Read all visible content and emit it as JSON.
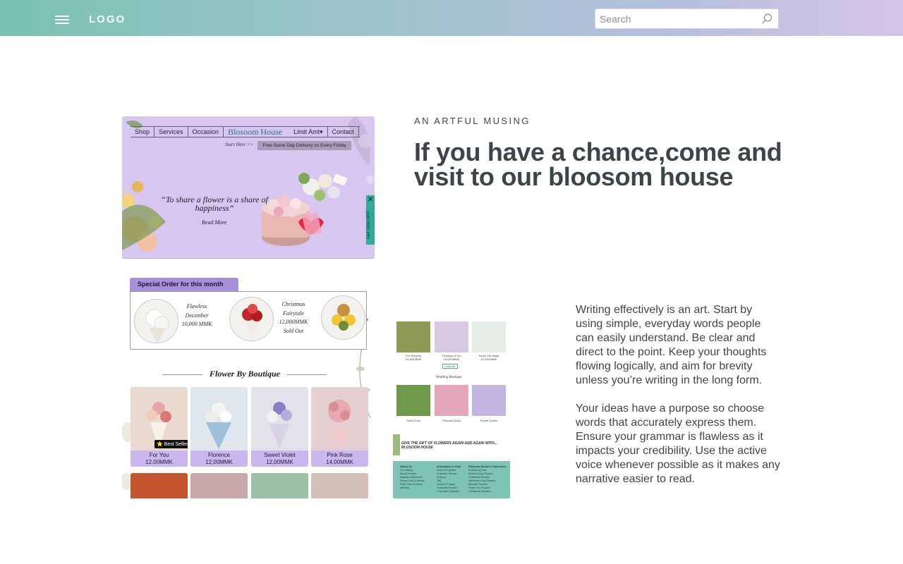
{
  "topbar": {
    "logo": "LOGO",
    "search_placeholder": "Search"
  },
  "intro": {
    "eyebrow": "AN ARTFUL MUSING",
    "headline": "If you have a chance,come and visit to our bloosom house"
  },
  "body": {
    "paragraph1": "Writing effectively is an art. Start by using simple, everyday words people can easily understand. Be clear and direct to the point. Keep your thoughts flowing logically, and aim for brevity unless you’re writing in the long form.",
    "paragraph2": "Your ideas have a purpose so choose words that accurately express them. Ensure your grammar is flawless as it impacts your credibility. Use the active voice whenever possible as it makes any narrative easier to read."
  },
  "shot1": {
    "nav": [
      "Shop",
      "Services",
      "Occasion",
      "Blosoom House",
      "Limit Amt▾",
      "Contact"
    ],
    "start_here": "Start Here >>",
    "delivery": "Free Same Day Delivery on Every Friday",
    "quote": "“To share a flower is a share of happiness”",
    "read_more": "Read More",
    "promo": "Get 30% OFF",
    "promo_close": "✕"
  },
  "shot2": {
    "special_tab": "Special Order for this month",
    "special_items": [
      {
        "name": "Flawless December",
        "price": "10,000 MMK"
      },
      {
        "name": "Christmas Fairytale",
        "price": "12,000MMK",
        "status": "Sold Out"
      }
    ],
    "section_title": "Flower By Boutique",
    "products": [
      {
        "name": "For You",
        "price": "12,00MMK",
        "badge": "⭐ Best Seller",
        "color": "#e8d9cf"
      },
      {
        "name": "Florence",
        "price": "12,00MMK",
        "color": "#b9cfe0"
      },
      {
        "name": "Sweet Violet",
        "price": "12,00MMK",
        "color": "#c9c4e0"
      },
      {
        "name": "Pink Rose",
        "price": "14,00MMK",
        "color": "#e7b8bd"
      }
    ]
  },
  "shot3": {
    "top_items": [
      {
        "name": "The Serenity",
        "price": "15,000 MMK"
      },
      {
        "name": "Thinking of You",
        "price": "15,000 MMK"
      },
      {
        "name": "Never Far Away",
        "price": "15,000 MMK"
      }
    ],
    "view_all": "View All",
    "wedding_title": "Wedding Boutique",
    "wedding_items": [
      "Snow Drop",
      "Princess Diary",
      "Purple Queen"
    ],
    "gift_line": "GIVE THE GIFT OF FLOWERS AGAIN AND AGAIN WITH... BLOSOOM HOUSE",
    "footer_cols": [
      {
        "title": "About Us",
        "items": [
          "Our History",
          "About Flowers",
          "Making a Difference",
          "Flower Care & Advice",
          "Plant Care & Advice",
          "Sitemap"
        ]
      },
      {
        "title": "Information & Help",
        "items": [
          "Covid-19 Update",
          "Customer Service",
          "Delivery",
          "FAQ",
          "Terms & Privacy",
          "Corporate Florists",
          "Corporate Hampers"
        ]
      },
      {
        "title": "Blosoom House's Collections",
        "items": [
          "Flowers by Post",
          "Mother's Day Flowers",
          "Christmas Flowers",
          "Valentine's Day Flowers",
          "Birthday Flowers",
          "Thank You Flowers",
          "Christmas Hampers"
        ]
      }
    ]
  }
}
